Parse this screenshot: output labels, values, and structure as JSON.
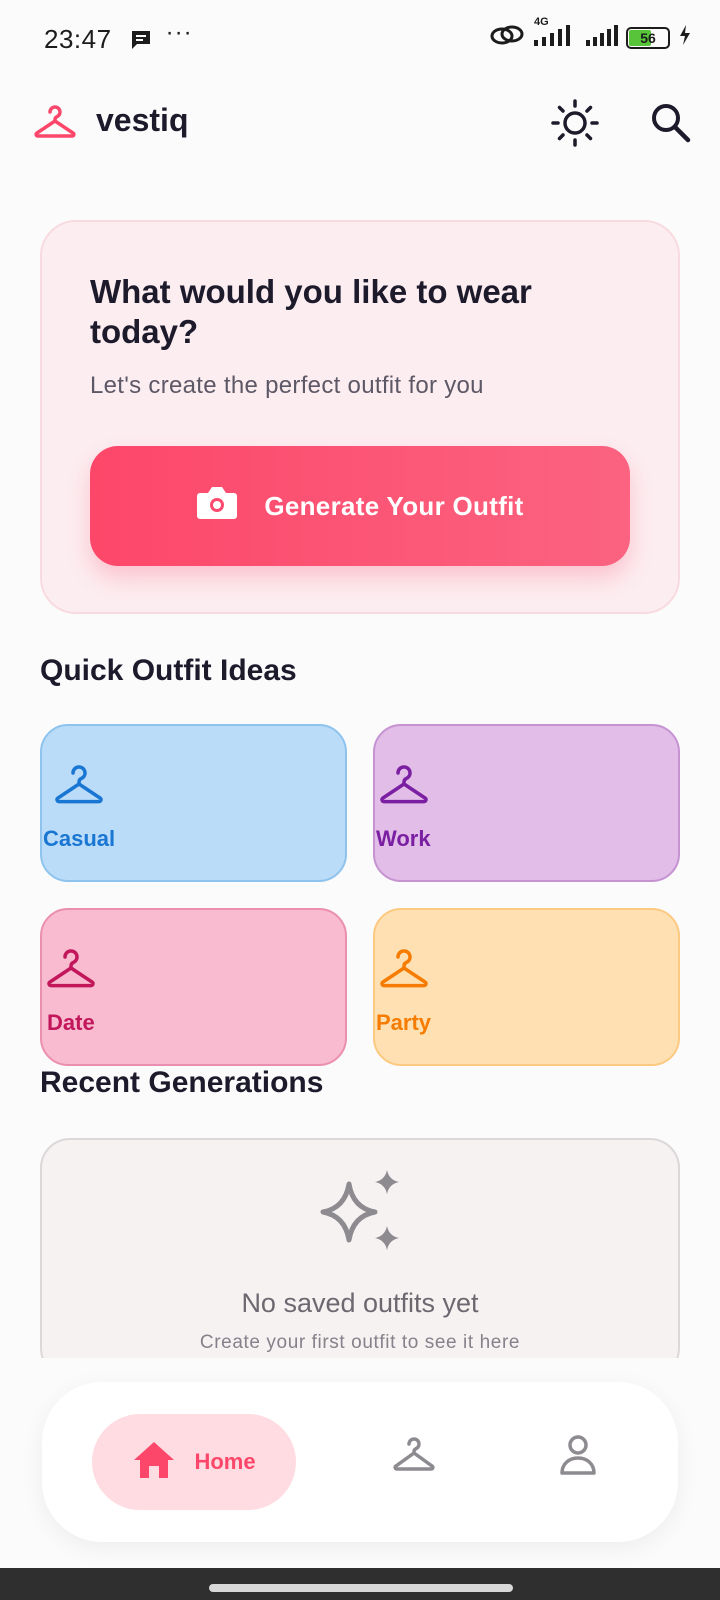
{
  "status_bar": {
    "time": "23:47",
    "battery": "56",
    "network": "4G",
    "icons": [
      "message-icon",
      "more-dots-icon",
      "link-icon",
      "signal-icon",
      "signal-icon",
      "battery-icon",
      "charging-icon"
    ]
  },
  "app_bar": {
    "brand": "vestiq",
    "icons": [
      "hanger-icon",
      "sun-icon",
      "search-icon"
    ]
  },
  "hero": {
    "title": "What would you like to wear today?",
    "subtitle": "Let's create the perfect outfit for you",
    "button_label": "Generate Your Outfit",
    "button_icon": "camera-icon"
  },
  "quick_ideas": {
    "title": "Quick Outfit Ideas",
    "items": [
      {
        "label": "Casual",
        "color": "#1976d2"
      },
      {
        "label": "Work",
        "color": "#7b1fa2"
      },
      {
        "label": "Date",
        "color": "#c2185b"
      },
      {
        "label": "Party",
        "color": "#f57c00"
      }
    ]
  },
  "recent": {
    "title": "Recent Generations",
    "empty_title": "No saved outfits yet",
    "empty_subtitle": "Create your first outfit to see it here",
    "empty_icon": "sparkles-icon"
  },
  "bottom_nav": {
    "home_label": "Home",
    "items": [
      "home-icon",
      "hanger-icon",
      "person-icon"
    ]
  },
  "colors": {
    "accent": "#fd476a",
    "hero_bg": "#fcedf0",
    "text_dark": "#1c1a2b"
  }
}
